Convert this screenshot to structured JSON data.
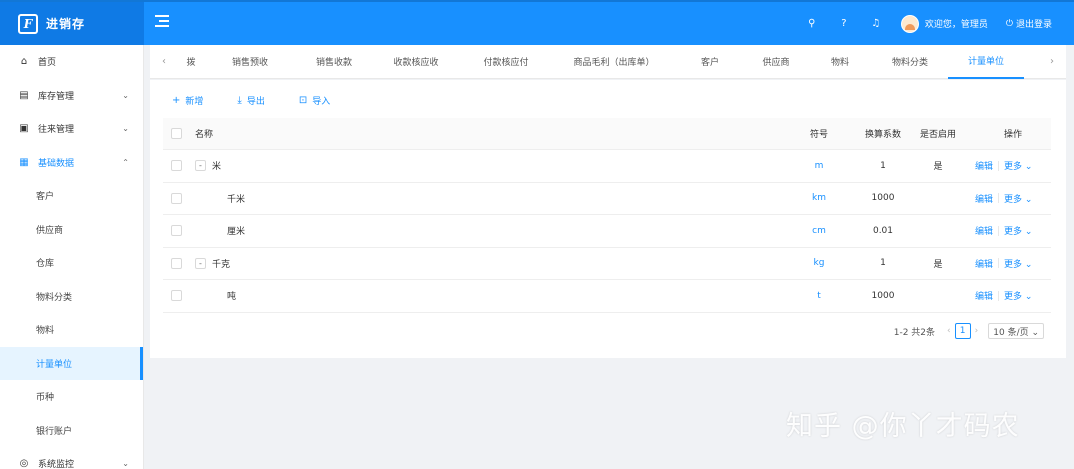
{
  "app": {
    "logo_mark": "F",
    "title": "进销存"
  },
  "header": {
    "icons": [
      "search-icon",
      "help-icon",
      "bell-icon"
    ],
    "icon_glyphs": [
      "⚲",
      "?",
      "♫"
    ],
    "welcome": "欢迎您，管理员",
    "logout": "退出登录",
    "logout_glyph": "⏻",
    "brand_color": "#1890ff"
  },
  "sidebar": {
    "home": "首页",
    "inventory": "库存管理",
    "contacts": "往来管理",
    "basic_data": "基础数据",
    "sub_items": [
      "客户",
      "供应商",
      "仓库",
      "物料分类",
      "物料",
      "计量单位",
      "币种",
      "银行账户"
    ],
    "active_sub": "计量单位",
    "system": "系统监控"
  },
  "tabs": {
    "prev": "‹",
    "next": "›",
    "items": [
      "拨",
      "销售预收",
      "销售收款",
      "收款核应收",
      "付款核应付",
      "商品毛利（出库单）",
      "客户",
      "供应商",
      "物料",
      "物料分类",
      "计量单位"
    ],
    "active": "计量单位"
  },
  "toolbar": {
    "add": "新增",
    "export": "导出",
    "import": "导入"
  },
  "table": {
    "columns": {
      "name": "名称",
      "symbol": "符号",
      "rate": "换算系数",
      "enabled": "是否启用",
      "ops": "操作"
    },
    "rows": [
      {
        "name": "米",
        "symbol": "m",
        "rate": "1",
        "enabled": "是",
        "parent": true,
        "expand": "-"
      },
      {
        "name": "千米",
        "symbol": "km",
        "rate": "1000",
        "enabled": "",
        "parent": false
      },
      {
        "name": "厘米",
        "symbol": "cm",
        "rate": "0.01",
        "enabled": "",
        "parent": false
      },
      {
        "name": "千克",
        "symbol": "kg",
        "rate": "1",
        "enabled": "是",
        "parent": true,
        "expand": "-"
      },
      {
        "name": "吨",
        "symbol": "t",
        "rate": "1000",
        "enabled": "",
        "parent": false
      }
    ],
    "edit": "编辑",
    "more": "更多 ⌄"
  },
  "pagination": {
    "total": "1-2 共2条",
    "prev": "‹",
    "page": "1",
    "next": "›",
    "size": "10 条/页 ⌄"
  },
  "watermark": "知乎 @你丫才码农"
}
